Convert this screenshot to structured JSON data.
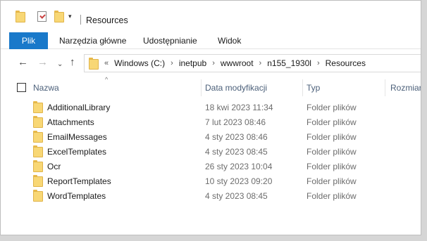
{
  "window": {
    "title": "Resources"
  },
  "quick_access": {
    "icons": [
      "folder-icon",
      "properties-icon",
      "new-folder-icon",
      "customize-dropdown-icon"
    ],
    "dropdown_glyph": "▾"
  },
  "ribbon": {
    "tabs": [
      {
        "label": "Plik",
        "active": true
      },
      {
        "label": "Narzędzia główne"
      },
      {
        "label": "Udostępnianie"
      },
      {
        "label": "Widok"
      }
    ],
    "accent_color": "#1979ca"
  },
  "nav": {
    "back_glyph": "←",
    "forward_glyph": "→",
    "recent_glyph": "⌄",
    "up_glyph": "↑",
    "overflow_glyph": "«",
    "separator_glyph": "›",
    "breadcrumbs": [
      "Windows (C:)",
      "inetpub",
      "wwwroot",
      "n155_1930l",
      "Resources"
    ]
  },
  "columns": {
    "sort_glyph": "^",
    "name": "Nazwa",
    "date": "Data modyfikacji",
    "type": "Typ",
    "size": "Rozmiar"
  },
  "files": [
    {
      "name": "AdditionalLibrary",
      "date": "18 kwi 2023 11:34",
      "type": "Folder plików"
    },
    {
      "name": "Attachments",
      "date": "7 lut 2023 08:46",
      "type": "Folder plików"
    },
    {
      "name": "EmailMessages",
      "date": "4 sty 2023 08:46",
      "type": "Folder plików"
    },
    {
      "name": "ExcelTemplates",
      "date": "4 sty 2023 08:45",
      "type": "Folder plików"
    },
    {
      "name": "Ocr",
      "date": "26 sty 2023 10:04",
      "type": "Folder plików"
    },
    {
      "name": "ReportTemplates",
      "date": "10 sty 2023 09:20",
      "type": "Folder plików"
    },
    {
      "name": "WordTemplates",
      "date": "4 sty 2023 08:45",
      "type": "Folder plików"
    }
  ]
}
